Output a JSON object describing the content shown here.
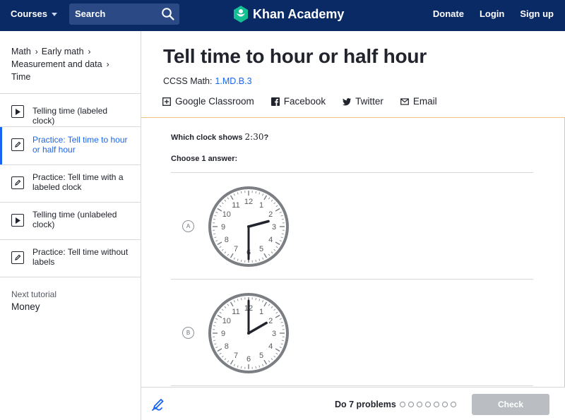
{
  "header": {
    "courses_label": "Courses",
    "search_label": "Search",
    "brand_name": "Khan Academy",
    "donate_label": "Donate",
    "login_label": "Login",
    "signup_label": "Sign up",
    "bg_color": "#0a2a66"
  },
  "breadcrumbs": {
    "items": [
      "Math",
      "Early math",
      "Measurement and data",
      "Time"
    ]
  },
  "sidebar": {
    "items": [
      {
        "label": "Telling time (labeled clock)",
        "icon": "play-icon",
        "active": false
      },
      {
        "label": "Practice: Tell time to hour or half hour",
        "icon": "pencil-icon",
        "active": true
      },
      {
        "label": "Practice: Tell time with a labeled clock",
        "icon": "pencil-icon",
        "active": false
      },
      {
        "label": "Telling time (unlabeled clock)",
        "icon": "play-icon",
        "active": false
      },
      {
        "label": "Practice: Tell time without labels",
        "icon": "pencil-icon",
        "active": false
      }
    ],
    "next_label": "Next tutorial",
    "next_name": "Money"
  },
  "main": {
    "title": "Tell time to hour or half hour",
    "ccss_prefix": "CCSS Math:",
    "ccss_code": "1.MD.B.3",
    "share": [
      "Google Classroom",
      "Facebook",
      "Twitter",
      "Email"
    ]
  },
  "exercise": {
    "question_prefix": "Which clock shows",
    "question_math": "2:30",
    "question_suffix": "?",
    "choose_label": "Choose 1 answer:",
    "choices": [
      {
        "letter": "A",
        "hour": 2,
        "minute": 30
      },
      {
        "letter": "B",
        "hour": 2,
        "minute": 0
      }
    ],
    "clock_numbers": [
      "12",
      "1",
      "2",
      "3",
      "4",
      "5",
      "6",
      "7",
      "8",
      "9",
      "10",
      "11"
    ]
  },
  "footer": {
    "do_label": "Do 7 problems",
    "progress_total": 7,
    "progress_done": 0,
    "check_label": "Check"
  },
  "colors": {
    "accent": "#1865f2",
    "exercise_border": "#f0c47f",
    "disabled_button": "#babec2"
  }
}
